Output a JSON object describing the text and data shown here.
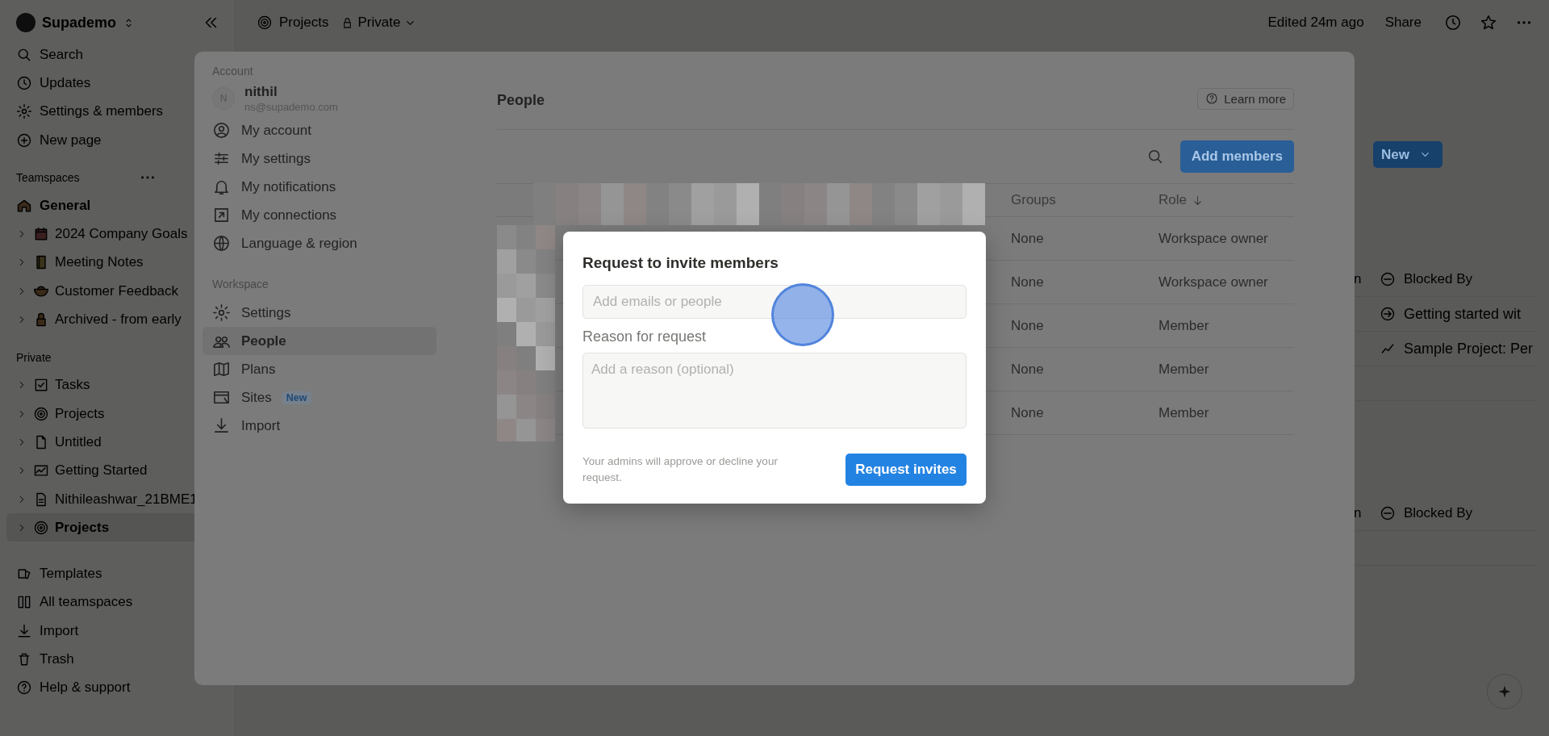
{
  "sidebar": {
    "workspace": "Supademo",
    "nav": [
      "Search",
      "Updates",
      "Settings & members",
      "New page"
    ],
    "teamspaces_heading": "Teamspaces",
    "teamspaces": [
      {
        "label": "General",
        "expandable": false
      },
      {
        "label": "2024 Company Goals",
        "expandable": true
      },
      {
        "label": "Meeting Notes",
        "expandable": true
      },
      {
        "label": "Customer Feedback",
        "expandable": true
      },
      {
        "label": "Archived - from early",
        "expandable": true
      }
    ],
    "private_heading": "Private",
    "private": [
      {
        "label": "Tasks",
        "selected": false
      },
      {
        "label": "Projects",
        "selected": false
      },
      {
        "label": "Untitled",
        "selected": false
      },
      {
        "label": "Getting Started",
        "selected": false
      },
      {
        "label": "Nithileashwar_21BME1",
        "selected": false
      },
      {
        "label": "Projects",
        "selected": true
      }
    ],
    "footer": [
      "Templates",
      "All teamspaces",
      "Import",
      "Trash",
      "Help & support"
    ]
  },
  "topbar": {
    "page": "Projects",
    "privacy": "Private",
    "edited": "Edited 24m ago",
    "share": "Share"
  },
  "page": {
    "new_button": "New",
    "tables": [
      {
        "column_fragment": "n",
        "relation_heading": "Blocked By",
        "rows": [
          "Getting started wit",
          "Sample Project: Per"
        ]
      },
      {
        "column_fragment": "n",
        "relation_heading": "Blocked By"
      }
    ]
  },
  "settings": {
    "account_heading": "Account",
    "user": {
      "initial": "N",
      "name": "nithil",
      "email": "ns@supademo.com"
    },
    "account_items": [
      {
        "label": "My account",
        "selected": false
      },
      {
        "label": "My settings",
        "selected": false
      },
      {
        "label": "My notifications",
        "selected": false
      },
      {
        "label": "My connections",
        "selected": false
      },
      {
        "label": "Language & region",
        "selected": false
      }
    ],
    "workspace_heading": "Workspace",
    "workspace_items": [
      {
        "label": "Settings",
        "selected": false
      },
      {
        "label": "People",
        "selected": true
      },
      {
        "label": "Plans",
        "selected": false
      },
      {
        "label": "Sites",
        "selected": false,
        "badge": "New"
      },
      {
        "label": "Import",
        "selected": false
      }
    ],
    "title": "People",
    "learn_more": "Learn more",
    "add_members": "Add members",
    "table": {
      "columns": [
        "Groups",
        "Role"
      ],
      "rows": [
        {
          "groups": "None",
          "role": "Workspace owner"
        },
        {
          "groups": "None",
          "role": "Workspace owner"
        },
        {
          "groups": "None",
          "role": "Member"
        },
        {
          "groups": "None",
          "role": "Member"
        },
        {
          "groups": "None",
          "role": "Member"
        }
      ]
    }
  },
  "dialog": {
    "title": "Request to invite members",
    "emails_placeholder": "Add emails or people",
    "reason_label": "Reason for request",
    "reason_placeholder": "Add a reason (optional)",
    "note": "Your admins will approve or decline your request.",
    "button": "Request invites"
  }
}
